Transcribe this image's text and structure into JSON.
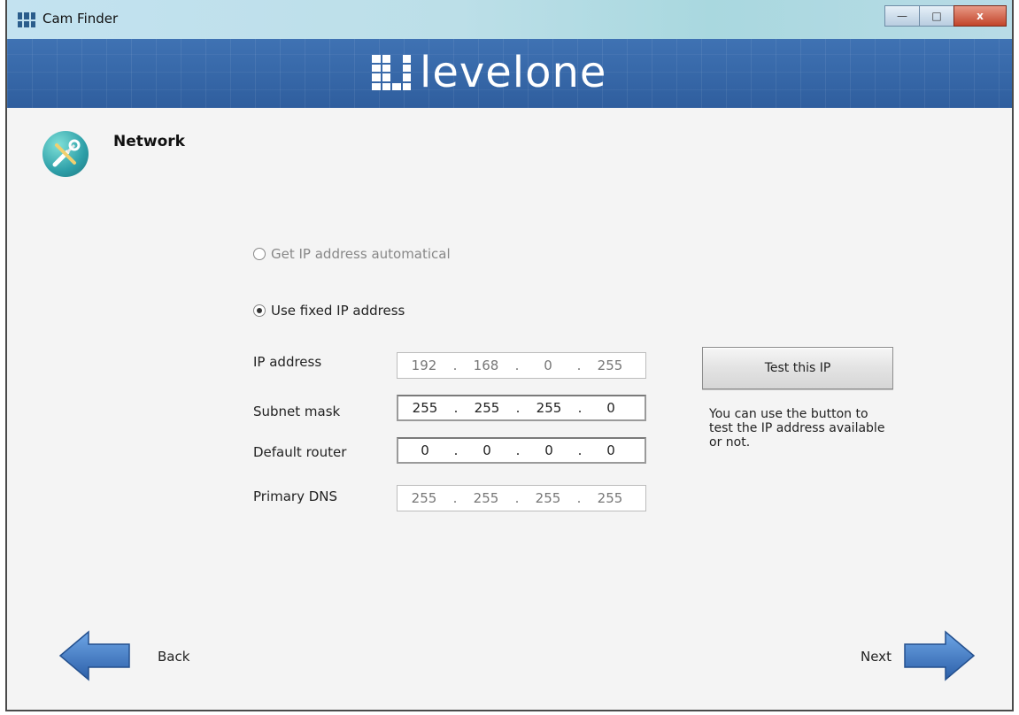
{
  "window": {
    "title": "Cam Finder",
    "minimize_glyph": "—",
    "maximize_glyph": "□",
    "close_glyph": "x"
  },
  "banner": {
    "logo_text": "levelone"
  },
  "section": {
    "icon": "tools-icon",
    "title": "Network"
  },
  "options": {
    "auto_label": "Get IP address automatical",
    "auto_selected": false,
    "fixed_label": "Use fixed IP address",
    "fixed_selected": true
  },
  "fields": [
    {
      "label": "IP address",
      "octets": [
        "192",
        "168",
        "0",
        "255"
      ]
    },
    {
      "label": "Subnet mask",
      "octets": [
        "255",
        "255",
        "255",
        "0"
      ]
    },
    {
      "label": "Default router",
      "octets": [
        "0",
        "0",
        "0",
        "0"
      ]
    },
    {
      "label": "Primary DNS",
      "octets": [
        "255",
        "255",
        "255",
        "255"
      ]
    }
  ],
  "test_button": {
    "label": "Test this IP"
  },
  "hint_text": "You can use the button to test the IP address available or not.",
  "nav": {
    "back_label": "Back",
    "next_label": "Next"
  },
  "colors": {
    "banner": "#3566a8",
    "arrow": "#3f77c4"
  }
}
